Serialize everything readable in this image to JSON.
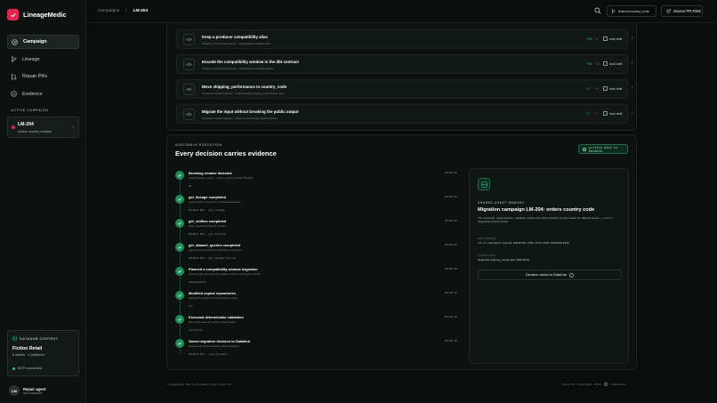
{
  "brand": {
    "name": "LineageMedic",
    "accent": "#e0264a"
  },
  "sidebar": {
    "items": [
      {
        "label": "Campaign",
        "icon": "compass-icon",
        "active": true
      },
      {
        "label": "Lineage",
        "icon": "git-branch-icon",
        "active": false
      },
      {
        "label": "Repair PRs",
        "icon": "git-pull-request-icon",
        "active": false
      },
      {
        "label": "Evidence",
        "icon": "shield-check-icon",
        "active": false
      }
    ],
    "active_campaign_label": "ACTIVE CAMPAIGN",
    "campaign": {
      "id": "LM-204",
      "name": "orders country rename"
    },
    "datahub": {
      "label": "DATAHUB CONTEXT",
      "org": "Fiction Retail",
      "meta": "6 assets · 4 platforms",
      "mcp": "MCP connected"
    },
    "agent": {
      "initials": "LM",
      "name": "Repair agent",
      "role": "via workspace"
    }
  },
  "topbar": {
    "crumb_root": "Campaigns",
    "crumb_sep": "/",
    "crumb_current": "LM-204",
    "branch": "feature/country-code",
    "source_button": "Source PR #204"
  },
  "steps": [
    {
      "title": "Keep a producer compatibility alias",
      "desc": "Producer contract amendment  ·  backwards-compatible alias",
      "plus": "+58",
      "minus": "−6",
      "badge": "local draft"
    },
    {
      "title": "Encode the compatibility window in the dbt contract",
      "desc": "Producer contract amendment  ·  backwards-compatible window",
      "plus": "+98",
      "minus": "−14",
      "badge": "local draft"
    },
    {
      "title": "Move shipping_performance to country_code",
      "desc": "Consumer model migration  ·  rename field in shipping_performance view",
      "plus": "+7",
      "minus": "−3",
      "badge": "local draft"
    },
    {
      "title": "Migrate the input without breaking the public output",
      "desc": "Consumer model migration  ·  preserve downstream public schema",
      "plus": "+7",
      "minus": "−2",
      "badge": "local draft"
    }
  ],
  "evidence": {
    "kicker": "AUDITABLE EXECUTION",
    "title": "Every decision carries evidence",
    "button": "written back to DataHub",
    "timeline": [
      {
        "title": "Breaking rename detected",
        "desc": "orders.shipping_country → country_code in producer PR #204",
        "tag": "PR",
        "time": "09:00:00"
      },
      {
        "title": "get_lineage completed",
        "desc": "Lineage graph resolved for 6 downstream datasets",
        "tag": "DataHub MCP  ·  get_lineage",
        "time": "09:00:02"
      },
      {
        "title": "get_entities completed",
        "desc": "Entity metadata fetched for 6 assets",
        "tag": "DataHub MCP  ·  get_entities",
        "time": "09:00:03"
      },
      {
        "title": "get_dataset_queries completed",
        "desc": "Query history inspected for downstream consumers",
        "tag": "DataHub MCP  ·  get_dataset_queries",
        "time": "09:00:05"
      },
      {
        "title": "Planned a compatibility window migration",
        "desc": "Producer alias plus consumer migrations before removing the old field",
        "tag": "CampaignPlan",
        "time": "09:00:08"
      },
      {
        "title": "Modified copied repositories",
        "desc": "Draft patches applied to local workspace copies",
        "tag": "Git",
        "time": "09:00:12"
      },
      {
        "title": "Executed deterministic validation",
        "desc": "dbt compile, tests and contract checks passed",
        "tag": "Validation",
        "time": "09:00:15"
      },
      {
        "title": "Saved migration decision to DataHub",
        "desc": "Decision and evidence linked to affected datasets",
        "tag": "DataHub MCP  ·  save_document",
        "time": "09:00:18"
      }
    ],
    "memory": {
      "kicker": "SHARED AGENT MEMORY",
      "title": "Migration campaign LM-204: orders country code",
      "desc": "The reasoning, repair patches, validation results and rollout window now live beside the affected assets — not in a disposable chat transcript.",
      "doc_label": "DOCUMENT",
      "doc_value": "urn:li:document:shared-6da9f120-7f9b-4f79-b53d-2f0db76fe39b",
      "window_label": "LIFECYCLE",
      "window_value": "Deprecate shipping_country after 2026-09-01",
      "saved": "Decision saved to DataHub"
    }
  },
  "footer": {
    "left": "LineageMedic · Built on the DataHub Agent Context Kit",
    "right": "Source PR · Fiction Retail · 09:00",
    "right_link": "DataHub live"
  }
}
